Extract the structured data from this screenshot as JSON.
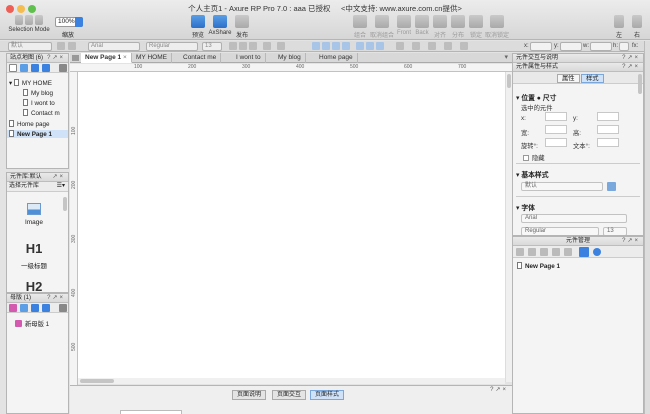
{
  "window": {
    "title": "个人主页1 - Axure RP Pro 7.0 : aaa 已授权",
    "support": "<中文支持: www.axure.com.cn提供>"
  },
  "toolbar": {
    "selection_mode": "Selection Mode",
    "zoom_value": "100%",
    "zoom_label": "缩放",
    "preview": "预览",
    "axshare": "AxShare",
    "publish": "发布",
    "group": "组合",
    "ungroup": "取消组合",
    "front": "Front",
    "back": "Back",
    "align": "对齐",
    "distribute": "分布",
    "lock": "锁定",
    "unlock": "取消锁定",
    "left": "左",
    "right": "右"
  },
  "formatbar": {
    "style_value": "默认",
    "font_value": "Arial",
    "weight_value": "Regular",
    "size_value": "13",
    "x_label": "x:",
    "y_label": "y:",
    "w_label": "w:",
    "h_label": "h:",
    "f_label": "fx:"
  },
  "sitemap": {
    "title": "站点地图 (6)",
    "items": [
      {
        "label": "MY HOME"
      },
      {
        "label": "My blog"
      },
      {
        "label": "I wont to"
      },
      {
        "label": "Contact m"
      },
      {
        "label": "Home page"
      },
      {
        "label": "New Page 1"
      }
    ]
  },
  "widgets": {
    "title": "元件库:默认",
    "library_label": "选择元件库",
    "items": [
      {
        "label": "Image",
        "preview": ""
      },
      {
        "label": "一级标题",
        "preview": "H1"
      },
      {
        "label": "",
        "preview": "H2"
      }
    ]
  },
  "masters": {
    "title": "母版 (1)",
    "items": [
      {
        "label": "新母版 1"
      }
    ]
  },
  "tabs": [
    {
      "label": "New Page 1"
    },
    {
      "label": "MY HOME"
    },
    {
      "label": "Contact me"
    },
    {
      "label": "I wont to"
    },
    {
      "label": "My blog"
    },
    {
      "label": "Home page"
    }
  ],
  "ruler": {
    "top": [
      "100",
      "200",
      "300",
      "400",
      "500",
      "600",
      "700"
    ],
    "left": [
      "100",
      "200",
      "300",
      "400",
      "500"
    ]
  },
  "notes_tabs": [
    {
      "label": "页面说明"
    },
    {
      "label": "页面交互"
    },
    {
      "label": "页面样式"
    }
  ],
  "inspector": {
    "title1": "元件交互与说明",
    "title2": "元件属性与样式",
    "tab_props": "属性",
    "tab_style": "样式",
    "position_section": "位置 ● 尺寸",
    "selected_label": "选中的元件",
    "x": "x:",
    "y": "y:",
    "w": "宽:",
    "h": "高:",
    "rotate": "旋转°:",
    "text_rotate": "文本°:",
    "hidden": "隐藏",
    "base_style_section": "基本样式",
    "base_style_value": "默认",
    "font_section": "字体",
    "font_value": "Arial",
    "weight_value": "Regular",
    "size_value": "13"
  },
  "outline": {
    "title": "元件管理",
    "page": "New Page 1"
  },
  "colors": {
    "accent": "#3b82e0",
    "selected": "#cfe2f7"
  }
}
